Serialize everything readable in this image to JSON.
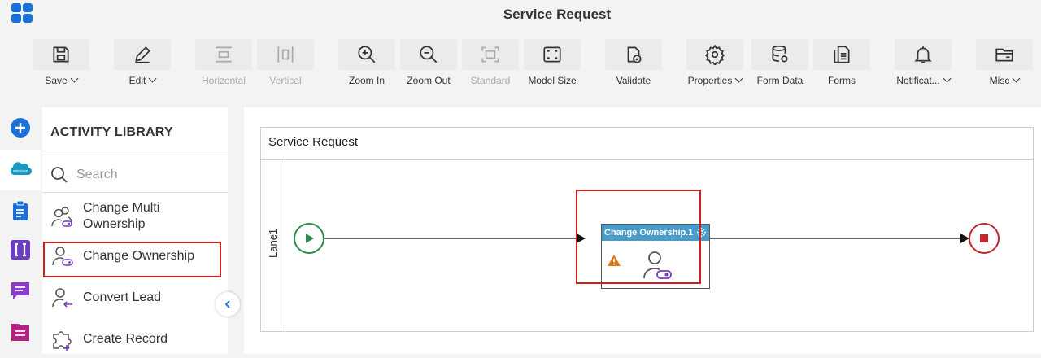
{
  "app": {
    "title": "Service Request"
  },
  "toolbar": {
    "save": "Save",
    "edit": "Edit",
    "horizontal": "Horizontal",
    "vertical": "Vertical",
    "zoom_in": "Zoom In",
    "zoom_out": "Zoom Out",
    "standard": "Standard",
    "model_size": "Model Size",
    "validate": "Validate",
    "properties": "Properties",
    "form_data": "Form Data",
    "forms": "Forms",
    "notifications": "Notificat...",
    "misc": "Misc"
  },
  "library": {
    "heading": "ACTIVITY LIBRARY",
    "search_placeholder": "Search",
    "items": [
      {
        "line1": "Change Multi",
        "line2": "Ownership"
      },
      {
        "label": "Change Ownership"
      },
      {
        "label": "Convert Lead"
      },
      {
        "label": "Create Record"
      }
    ]
  },
  "canvas": {
    "pool_title": "Service Request",
    "lane": "Lane1",
    "task_title": "Change Ownership.1"
  },
  "icons": {
    "rail": [
      "plus-circle-icon",
      "salesforce-cloud-icon",
      "clipboard-icon",
      "integration-icon",
      "chat-icon",
      "document-icon"
    ]
  },
  "colors": {
    "accent_blue": "#1b6fd8",
    "task_header": "#4a9cc8",
    "start_green": "#2e8b4a",
    "end_red": "#c0282d",
    "highlight_red": "#d11f1f",
    "purple": "#7a3cc8",
    "magenta": "#b0237f"
  }
}
